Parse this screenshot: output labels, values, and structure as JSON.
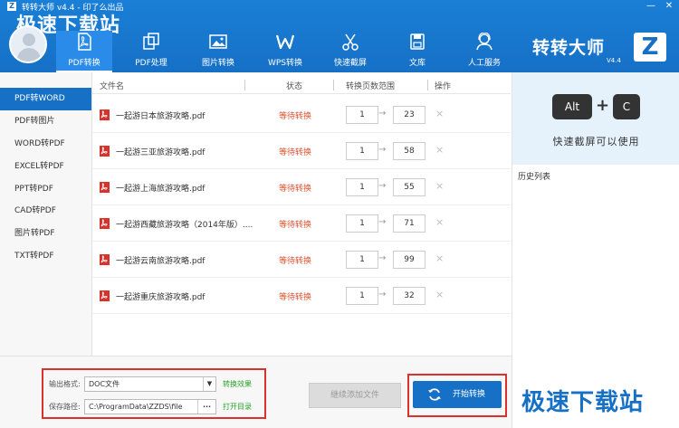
{
  "window": {
    "title": "转转大师 v4.4 - 印了么出品",
    "watermark": "极速下载站",
    "minimize": "—",
    "close": "✕"
  },
  "nav": {
    "tabs": [
      {
        "label": "PDF转换",
        "icon": "pdf-icon"
      },
      {
        "label": "PDF处理",
        "icon": "pdf-process-icon"
      },
      {
        "label": "图片转换",
        "icon": "image-icon"
      },
      {
        "label": "WPS转换",
        "icon": "wps-icon"
      },
      {
        "label": "快速截屏",
        "icon": "scissors-icon"
      },
      {
        "label": "文库",
        "icon": "library-icon"
      },
      {
        "label": "人工服务",
        "icon": "support-icon"
      }
    ],
    "active_index": 0
  },
  "brand": {
    "name": "转转大师",
    "logo_letter": "Z",
    "version": "V4.4"
  },
  "sidebar": {
    "items": [
      {
        "label": "PDF转WORD"
      },
      {
        "label": "PDF转图片"
      },
      {
        "label": "WORD转PDF"
      },
      {
        "label": "EXCEL转PDF"
      },
      {
        "label": "PPT转PDF"
      },
      {
        "label": "CAD转PDF"
      },
      {
        "label": "图片转PDF"
      },
      {
        "label": "TXT转PDF"
      }
    ],
    "active_index": 0
  },
  "table": {
    "headers": {
      "name": "文件名",
      "status": "状态",
      "range": "转换页数范围",
      "action": "操作"
    },
    "rows": [
      {
        "name": "一起游日本旅游攻略.pdf",
        "status": "等待转换",
        "from": "1",
        "to": "23"
      },
      {
        "name": "一起游三亚旅游攻略.pdf",
        "status": "等待转换",
        "from": "1",
        "to": "58"
      },
      {
        "name": "一起游上海旅游攻略.pdf",
        "status": "等待转换",
        "from": "1",
        "to": "55"
      },
      {
        "name": "一起游西藏旅游攻略（2014年版）....",
        "status": "等待转换",
        "from": "1",
        "to": "71"
      },
      {
        "name": "一起游云南旅游攻略.pdf",
        "status": "等待转换",
        "from": "1",
        "to": "99"
      },
      {
        "name": "一起游重庆旅游攻略.pdf",
        "status": "等待转换",
        "from": "1",
        "to": "32"
      }
    ],
    "arrow": "→",
    "delete": "×"
  },
  "right_panel": {
    "key1": "Alt",
    "plus": "+",
    "key2": "C",
    "hint": "快速截屏可以使用",
    "history_label": "历史列表"
  },
  "bottom": {
    "format_label": "输出格式:",
    "format_value": "DOC文件",
    "format_link": "转换效果",
    "path_label": "保存路径:",
    "path_value": "C:\\ProgramData\\ZZDS\\file",
    "path_browse": "···",
    "path_link": "打开目录",
    "continue_button": "继续添加文件",
    "start_button": "开始转换"
  },
  "colors": {
    "header_blue": "#1670c6",
    "status_red": "#e0522f",
    "link_green": "#2aa52a",
    "highlight_red": "#d9312b"
  }
}
